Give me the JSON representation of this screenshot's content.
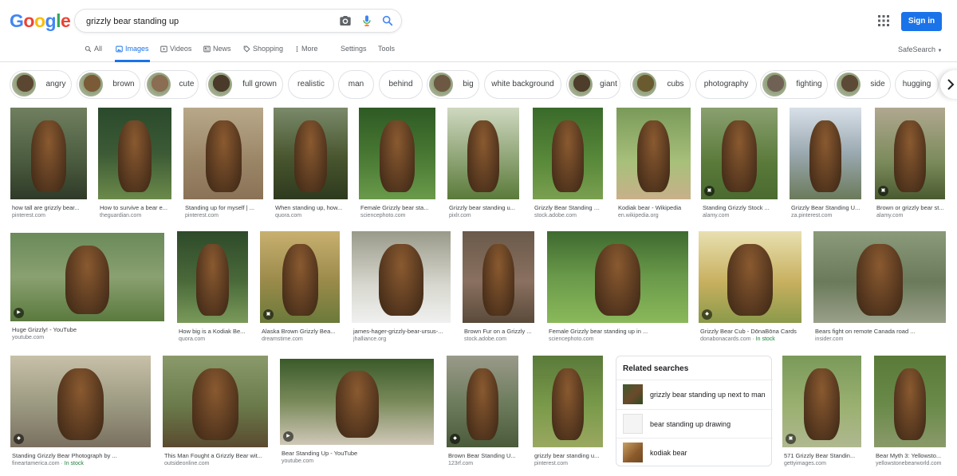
{
  "header": {
    "logo": [
      "G",
      "o",
      "o",
      "g",
      "l",
      "e"
    ],
    "logo_colors": [
      "#4285f4",
      "#ea4335",
      "#fbbc05",
      "#4285f4",
      "#34a853",
      "#ea4335"
    ],
    "search": {
      "value": "grizzly bear standing up"
    },
    "signin_label": "Sign in"
  },
  "tabs": [
    {
      "label": "All",
      "icon": "search-icon",
      "active": false
    },
    {
      "label": "Images",
      "icon": "image-icon",
      "active": true
    },
    {
      "label": "Videos",
      "icon": "video-icon",
      "active": false
    },
    {
      "label": "News",
      "icon": "news-icon",
      "active": false
    },
    {
      "label": "Shopping",
      "icon": "tag-icon",
      "active": false
    },
    {
      "label": "More",
      "icon": "more-vert-icon",
      "active": false
    },
    {
      "label": "Settings",
      "icon": "",
      "active": false
    },
    {
      "label": "Tools",
      "icon": "",
      "active": false
    }
  ],
  "safesearch_label": "SafeSearch",
  "chips": [
    {
      "label": "angry",
      "thumb": true
    },
    {
      "label": "brown",
      "thumb": true
    },
    {
      "label": "cute",
      "thumb": true
    },
    {
      "label": "full grown",
      "thumb": true
    },
    {
      "label": "realistic",
      "thumb": false
    },
    {
      "label": "man",
      "thumb": false
    },
    {
      "label": "behind",
      "thumb": false
    },
    {
      "label": "big",
      "thumb": true
    },
    {
      "label": "white background",
      "thumb": false
    },
    {
      "label": "giant",
      "thumb": true
    },
    {
      "label": "cubs",
      "thumb": true
    },
    {
      "label": "photography",
      "thumb": false
    },
    {
      "label": "fighting",
      "thumb": true
    },
    {
      "label": "side",
      "thumb": true
    },
    {
      "label": "hugging",
      "thumb": false
    }
  ],
  "results": [
    {
      "title": "how tall are grizzly bear...",
      "source": "pinterest.com"
    },
    {
      "title": "How to survive a bear e...",
      "source": "theguardian.com"
    },
    {
      "title": "Standing up for myself | ...",
      "source": "pinterest.com"
    },
    {
      "title": "When standing up, how...",
      "source": "quora.com"
    },
    {
      "title": "Female Grizzly bear sta...",
      "source": "sciencephoto.com"
    },
    {
      "title": "Grizzly bear standing u...",
      "source": "pixlr.com"
    },
    {
      "title": "Grizzly Bear Standing U...",
      "source": "stock.adobe.com"
    },
    {
      "title": "Kodiak bear - Wikipedia",
      "source": "en.wikipedia.org"
    },
    {
      "title": "Standing Grizzly Stock ...",
      "source": "alamy.com"
    },
    {
      "title": "Grizzly Bear Standing U...",
      "source": "za.pinterest.com"
    },
    {
      "title": "Brown or grizzly bear st...",
      "source": "alamy.com"
    },
    {
      "title": "Huge Grizzly! - YouTube",
      "source": "youtube.com"
    },
    {
      "title": "How big is a Kodiak Be...",
      "source": "quora.com"
    },
    {
      "title": "Alaska Brown Grizzly Bea...",
      "source": "dreamstime.com"
    },
    {
      "title": "james-hager-grizzly-bear-ursus-...",
      "source": "jhalliance.org"
    },
    {
      "title": "Brown Fur on a Grizzly ...",
      "source": "stock.adobe.com"
    },
    {
      "title": "Female Grizzly bear standing up in ...",
      "source": "sciencephoto.com"
    },
    {
      "title": "Grizzly Bear Cub - DōnaBōna Cards",
      "source": "donabonacards.com",
      "stock": "In stock"
    },
    {
      "title": "Bears fight on remote Canada road ...",
      "source": "insider.com"
    },
    {
      "title": "Standing Grizzly Bear Photograph by ...",
      "source": "fineartamerica.com",
      "stock": "In stock"
    },
    {
      "title": "This Man Fought a Grizzly Bear wit...",
      "source": "outsideonline.com"
    },
    {
      "title": "Bear Standing Up - YouTube",
      "source": "youtube.com"
    },
    {
      "title": "Brown Bear Standing U...",
      "source": "123rf.com"
    },
    {
      "title": "grizzly bear standing u...",
      "source": "pinterest.com"
    },
    {
      "title": "571 Grizzly Bear Standin...",
      "source": "gettyimages.com"
    },
    {
      "title": "Bear Myth 3: Yellowsto...",
      "source": "yellowstonebearworld.com"
    }
  ],
  "related": {
    "title": "Related searches",
    "items": [
      {
        "label": "grizzly bear standing up next to man"
      },
      {
        "label": "bear standing up drawing"
      },
      {
        "label": "kodiak bear"
      }
    ]
  }
}
